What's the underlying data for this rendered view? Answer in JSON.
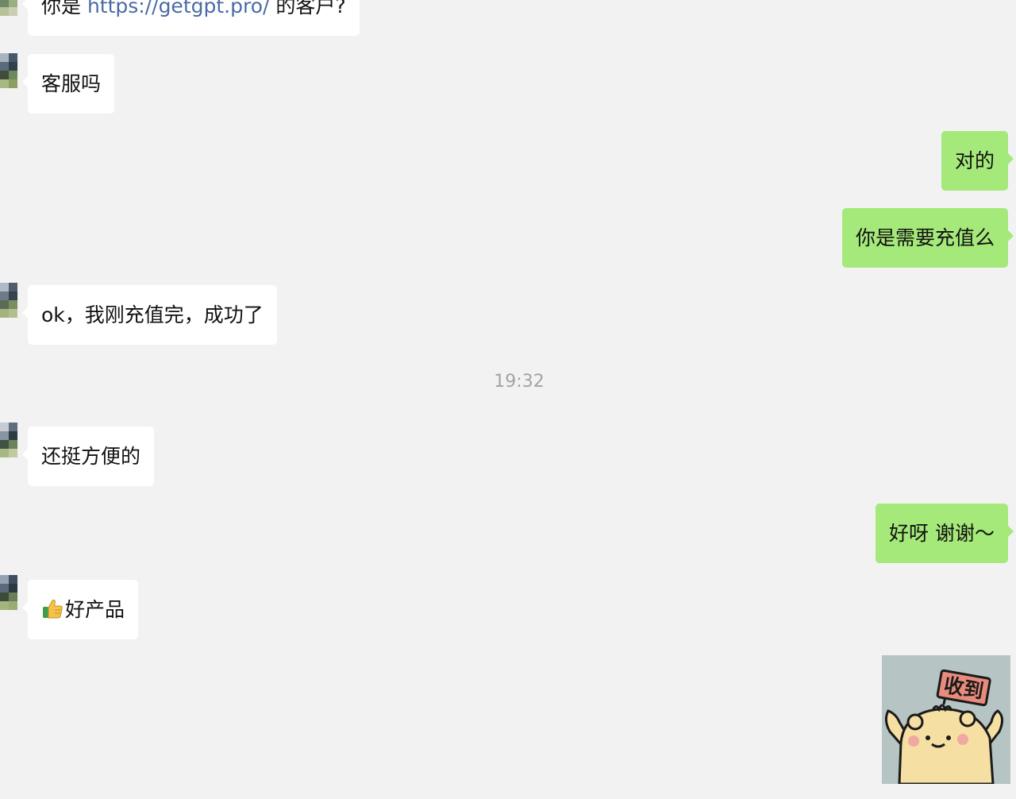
{
  "messages": [
    {
      "side": "in",
      "prefix": "你是 ",
      "link": "https://getgpt.pro/",
      "suffix": " 的客户?"
    },
    {
      "side": "in",
      "text": "客服吗"
    },
    {
      "side": "out",
      "text": "对的"
    },
    {
      "side": "out",
      "text": "你是需要充值么"
    },
    {
      "side": "in",
      "text": "ok，我刚充值完，成功了"
    },
    {
      "side": "in",
      "text": "还挺方便的"
    },
    {
      "side": "out",
      "text": "好呀 谢谢～"
    },
    {
      "side": "in",
      "emoji": "thumbs-up",
      "text": "好产品"
    }
  ],
  "timestamp": "19:32",
  "sticker": {
    "icon": "bear-holding-sign-sticker",
    "sign_text": "收到"
  },
  "colors": {
    "background": "#f2f2f2",
    "incoming_bubble": "#ffffff",
    "outgoing_bubble": "#a5e97a",
    "link": "#4a6aa5",
    "timestamp": "#a3a3a3"
  }
}
